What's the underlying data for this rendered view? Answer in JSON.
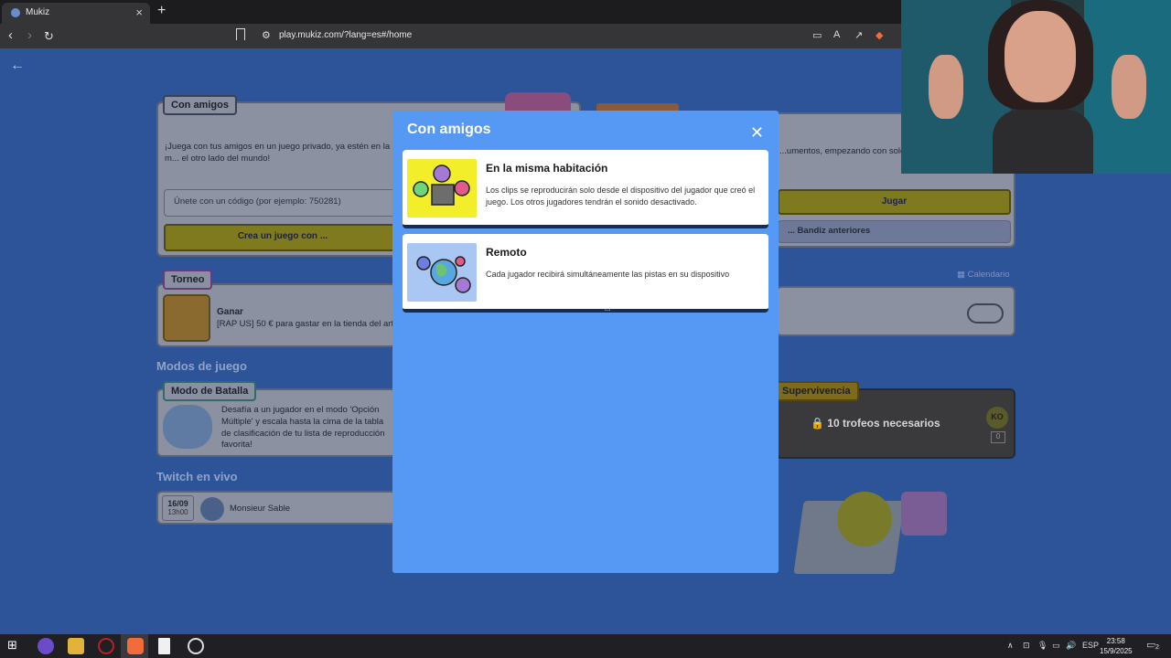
{
  "browser": {
    "tab_title": "Mukiz",
    "tab_close": "×",
    "new_tab": "+",
    "url": "play.mukiz.com/?lang=es#/home"
  },
  "page": {
    "friends_card": {
      "badge": "Con amigos",
      "description": "¡Juega con tus amigos en un juego privado, ya estén en la m... el otro lado del mundo!",
      "code_input_placeholder": "Únete con un código (por ejemplo: 750281)",
      "create_button": "Crea un juego con ..."
    },
    "right_card": {
      "text": "...umentos, empezando con solo",
      "play_button": "Jugar",
      "previous_button": "... Bandiz anteriores"
    },
    "tournament": {
      "badge": "Torneo",
      "title": "Ganar",
      "text": "[RAP US] 50 € para gastar en la tienda del art...",
      "calendar": "Calendario"
    },
    "game_modes": {
      "heading": "Modos de juego",
      "battle_badge": "Modo de Batalla",
      "battle_text": "Desafía a un jugador en el modo 'Opción Múltiple' y escala hasta la cima de la tabla de clasificación de tu lista de reproducción favorita!",
      "survival_badge": "Supervivencia",
      "survival_lock": "10 trofeos necesarios",
      "survival_counter": "0",
      "survival_ko": "KO"
    },
    "twitch": {
      "heading": "Twitch en vivo",
      "date": "16/09",
      "time": "13h00",
      "streamer": "Monsieur Sable"
    }
  },
  "modal": {
    "title": "Con amigos",
    "close": "✕",
    "options": [
      {
        "title": "En la misma habitación",
        "description": "Los clips se reproducirán solo desde el dispositivo del jugador que creó el juego. Los otros jugadores tendrán el sonido desactivado."
      },
      {
        "title": "Remoto",
        "description": "Cada jugador recibirá simultáneamente las pistas en su dispositivo"
      }
    ]
  },
  "taskbar": {
    "lang": "ESP",
    "time": "23:58",
    "date": "15/9/2025",
    "notifications": "2"
  }
}
